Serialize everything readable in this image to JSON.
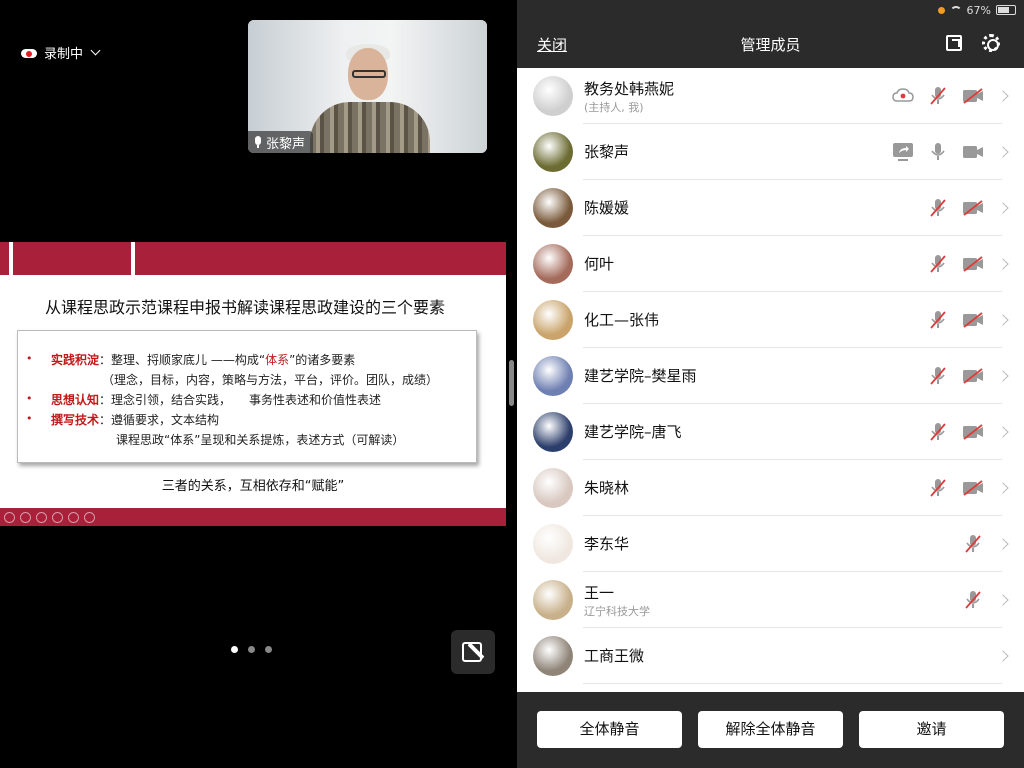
{
  "recording": {
    "label": "录制中"
  },
  "video": {
    "speaker": "张黎声"
  },
  "slide": {
    "title": "从课程思政示范课程申报书解读课程思政建设的三个要素",
    "bullets": [
      {
        "head": "实践积淀",
        "text_before": "：整理、捋顺家底儿 ——构成“",
        "highlight": "体系",
        "text_after": "”的诸多要素",
        "cont": "（理念，目标，内容，策略与方法，平台，评价。团队，成绩）"
      },
      {
        "head": "思想认知",
        "text": "：理念引领，结合实践，　　事务性表述和价值性表述"
      },
      {
        "head": "撰写技术",
        "text": "：遵循要求，文本结构",
        "cont": "课程思政“体系”呈现和关系提炼，表述方式（可解读）"
      }
    ],
    "bullet_mark": "•",
    "footer": "三者的关系，互相依存和“赋能”"
  },
  "status_bar": {
    "battery": "67%",
    "dots": "· · ·"
  },
  "panel": {
    "close": "关闭",
    "title": "管理成员"
  },
  "members": [
    {
      "name": "教务处韩燕妮",
      "sub": "(主持人, 我)",
      "status": "host",
      "avatar": "#cfcfcf"
    },
    {
      "name": "张黎声",
      "sub": "",
      "status": "sharing",
      "avatar": "#6b6b32"
    },
    {
      "name": "陈媛媛",
      "sub": "",
      "status": "muted",
      "avatar": "#7a5a3a"
    },
    {
      "name": "何叶",
      "sub": "",
      "status": "muted",
      "avatar": "#a46a5a"
    },
    {
      "name": "化工—张伟",
      "sub": "",
      "status": "muted",
      "avatar": "#c9a36a"
    },
    {
      "name": "建艺学院–樊星雨",
      "sub": "",
      "status": "muted",
      "avatar": "#6e7fb2"
    },
    {
      "name": "建艺学院–唐飞",
      "sub": "",
      "status": "muted",
      "avatar": "#2c3e6b"
    },
    {
      "name": "朱晓林",
      "sub": "",
      "status": "muted",
      "avatar": "#d8c8c0"
    },
    {
      "name": "李东华",
      "sub": "",
      "status": "mic-only",
      "avatar": "#f0e8e0"
    },
    {
      "name": "王一",
      "sub": "辽宁科技大学",
      "status": "mic-only",
      "avatar": "#c8b08a"
    },
    {
      "name": "工商王微",
      "sub": "",
      "status": "none",
      "avatar": "#8f8478"
    }
  ],
  "buttons": {
    "mute_all": "全体静音",
    "unmute_all": "解除全体静音",
    "invite": "邀请"
  }
}
